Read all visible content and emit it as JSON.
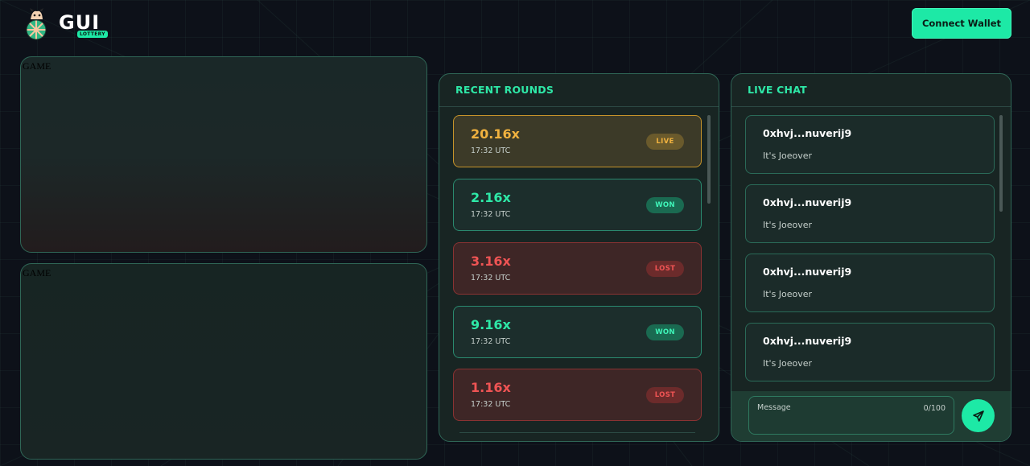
{
  "header": {
    "logo_text": "GUI",
    "logo_badge": "LOTTERY",
    "connect_wallet_label": "Connect Wallet"
  },
  "games": [
    {
      "label": "GAME"
    },
    {
      "label": "GAME"
    }
  ],
  "recent_rounds": {
    "title": "RECENT ROUNDS",
    "rounds": [
      {
        "multiplier": "20.16x",
        "time": "17:32 UTC",
        "status": "LIVE"
      },
      {
        "multiplier": "2.16x",
        "time": "17:32 UTC",
        "status": "WON"
      },
      {
        "multiplier": "3.16x",
        "time": "17:32 UTC",
        "status": "LOST"
      },
      {
        "multiplier": "9.16x",
        "time": "17:32 UTC",
        "status": "WON"
      },
      {
        "multiplier": "1.16x",
        "time": "17:32 UTC",
        "status": "LOST"
      }
    ]
  },
  "live_chat": {
    "title": "LIVE CHAT",
    "messages": [
      {
        "user": "0xhvj...nuverij9",
        "text": "It's Joeover"
      },
      {
        "user": "0xhvj...nuverij9",
        "text": "It's Joeover"
      },
      {
        "user": "0xhvj...nuverij9",
        "text": "It's Joeover"
      },
      {
        "user": "0xhvj...nuverij9",
        "text": "It's Joeover"
      }
    ],
    "input_placeholder": "Message",
    "input_value": "",
    "char_count": "0/100"
  },
  "colors": {
    "accent": "#1de9a6",
    "live": "#f1b23f",
    "won": "#2ee8a7",
    "lost": "#ef5454",
    "background": "#0d1119"
  },
  "icons": {
    "send": "send-icon",
    "logo": "mascot-logo-icon"
  }
}
